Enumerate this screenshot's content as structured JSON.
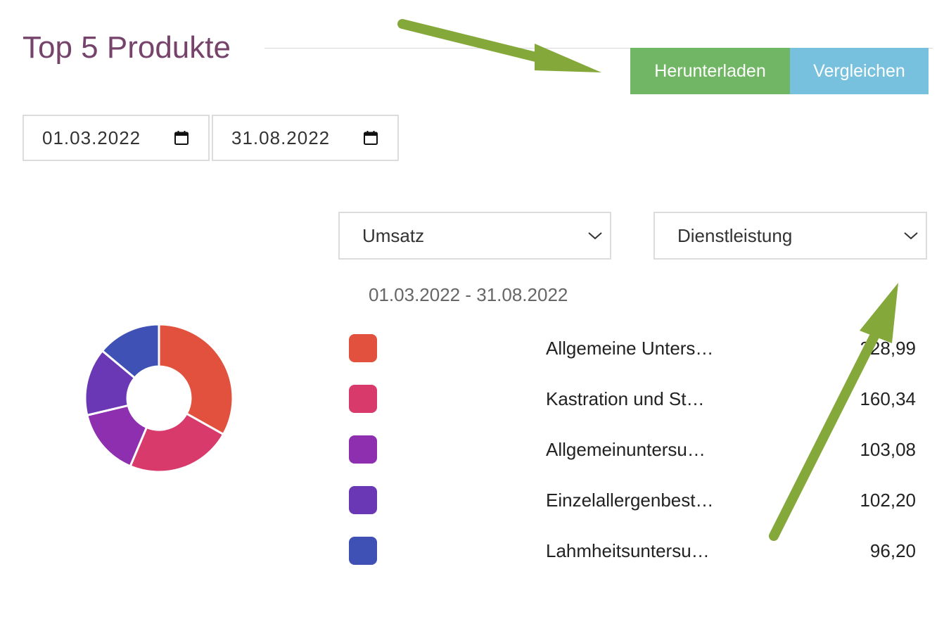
{
  "header": {
    "title": "Top 5 Produkte",
    "download_label": "Herunterladen",
    "compare_label": "Vergleichen",
    "download_color": "#71b665",
    "compare_color": "#77c1df"
  },
  "filters": {
    "date_from": "01.03.2022",
    "date_to": "31.08.2022",
    "metric_selected": "Umsatz",
    "type_selected": "Dienstleistung"
  },
  "range_label": "01.03.2022 - 31.08.2022",
  "chart_data": {
    "type": "pie",
    "donut": true,
    "categories": [
      "Allgemeine Unters…",
      "Kastration und St…",
      "Allgemeinuntersu…",
      "Einzelallergenbest…",
      "Lahmheitsuntersu…"
    ],
    "values": [
      228.99,
      160.34,
      103.08,
      102.2,
      96.2
    ],
    "value_labels": [
      "228,99",
      "160,34",
      "103,08",
      "102,20",
      "96,20"
    ],
    "colors": [
      "#e1513d",
      "#d83a6b",
      "#8e2fb0",
      "#6a38b4",
      "#3f51b5"
    ]
  },
  "annotation_color": "#84a93a"
}
